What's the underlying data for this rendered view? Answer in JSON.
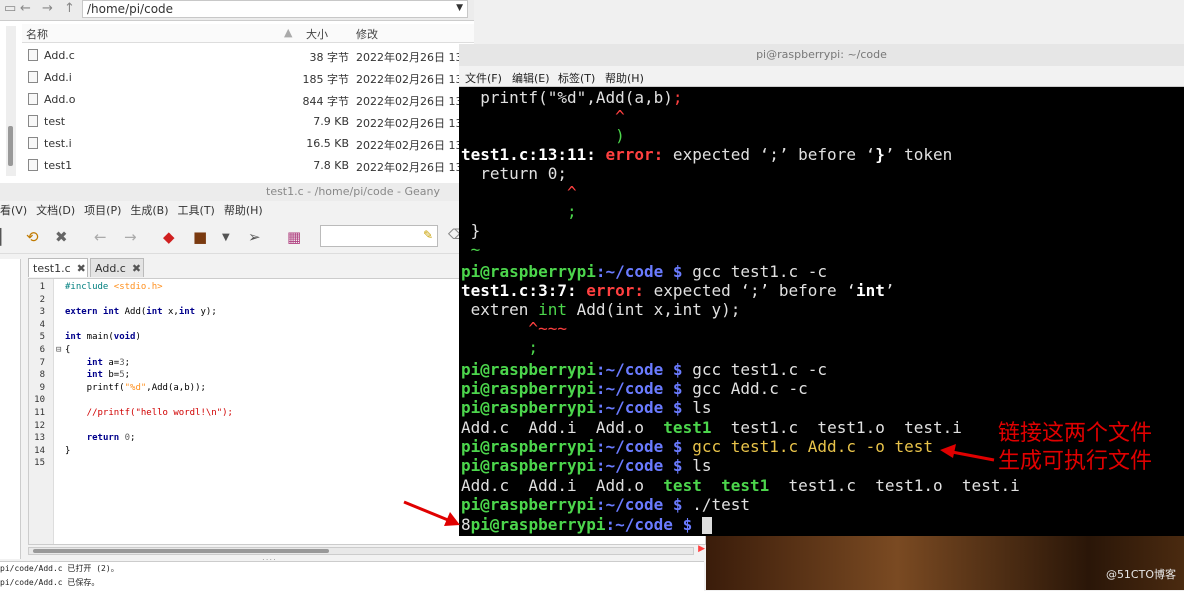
{
  "file_manager": {
    "path": "/home/pi/code",
    "columns": {
      "name": "名称",
      "size": "大小",
      "modified": "修改"
    },
    "files": [
      {
        "name": "Add.c",
        "size": "38 字节",
        "modified": "2022年02月26日 13:"
      },
      {
        "name": "Add.i",
        "size": "185 字节",
        "modified": "2022年02月26日 13:"
      },
      {
        "name": "Add.o",
        "size": "844 字节",
        "modified": "2022年02月26日 13:"
      },
      {
        "name": "test",
        "size": "7.9 KB",
        "modified": "2022年02月26日 13:"
      },
      {
        "name": "test.i",
        "size": "16.5 KB",
        "modified": "2022年02月26日 13:"
      },
      {
        "name": "test1",
        "size": "7.8 KB",
        "modified": "2022年02月26日 13:"
      }
    ]
  },
  "geany": {
    "title": "test1.c - /home/pi/code - Geany",
    "menu": [
      "看(V)",
      "文档(D)",
      "项目(P)",
      "生成(B)",
      "工具(T)",
      "帮助(H)"
    ],
    "tabs": [
      "test1.c",
      "Add.c"
    ],
    "code": [
      "#include <stdio.h>",
      "",
      "extern int Add(int x,int y);",
      "",
      "int main(void)",
      "{",
      "    int a=3;",
      "    int b=5;",
      "    printf(\"%d\",Add(a,b));",
      "",
      "    //printf(\"hello wordl!\\n\");",
      "",
      "    return 0;",
      "}",
      ""
    ],
    "messages": [
      "pi/code/Add.c 已打开 (2)。",
      "pi/code/Add.c 已保存。"
    ]
  },
  "terminal": {
    "title": "pi@raspberrypi: ~/code",
    "menu": [
      "文件(F)",
      "编辑(E)",
      "标签(T)",
      "帮助(H)"
    ],
    "prompt_user": "pi@raspberrypi",
    "prompt_path": ":~/code $",
    "lines": {
      "l1": "  printf(\"%d\",Add(a,b)",
      "l1_semi": ";",
      "l2": "                ^",
      "l3": "                )",
      "l4_loc": "test1.c:13:11:",
      "l4_err": " error:",
      "l4_msg": " expected ‘;’ before ‘",
      "l4_tok": "}",
      "l4_end": "’ token",
      "l5": "  return 0;",
      "l6": "           ^",
      "l7": "           ;",
      "l8": " }",
      "l9": " ~",
      "c1": " gcc test1.c -c",
      "e2_loc": "test1.c:3:7:",
      "e2_err": " error:",
      "e2_msg": " expected ‘;’ before ‘",
      "e2_tok": "int",
      "e2_end": "’",
      "e2_l2a": " extren ",
      "e2_l2b": "int",
      "e2_l2c": " Add(int x,int y);",
      "e2_l3": "       ^~~~",
      "e2_l4": "       ;",
      "c2": " gcc test1.c -c",
      "c3": " gcc Add.c -c",
      "c4": " ls",
      "ls1_a": "Add.c  Add.i  Add.o  ",
      "ls1_b": "test1",
      "ls1_c": "  test1.c  test1.o  test.i",
      "c5": " gcc test1.c Add.c -o test",
      "c6": " ls",
      "ls2_a": "Add.c  Add.i  Add.o  ",
      "ls2_b": "test",
      "ls2_c": "  ",
      "ls2_d": "test1",
      "ls2_e": "  test1.c  test1.o  test.i",
      "c7": " ./test",
      "out": "8"
    }
  },
  "annotation": {
    "line1": "链接这两个文件",
    "line2": "生成可执行文件"
  },
  "watermark": "@51CTO博客"
}
